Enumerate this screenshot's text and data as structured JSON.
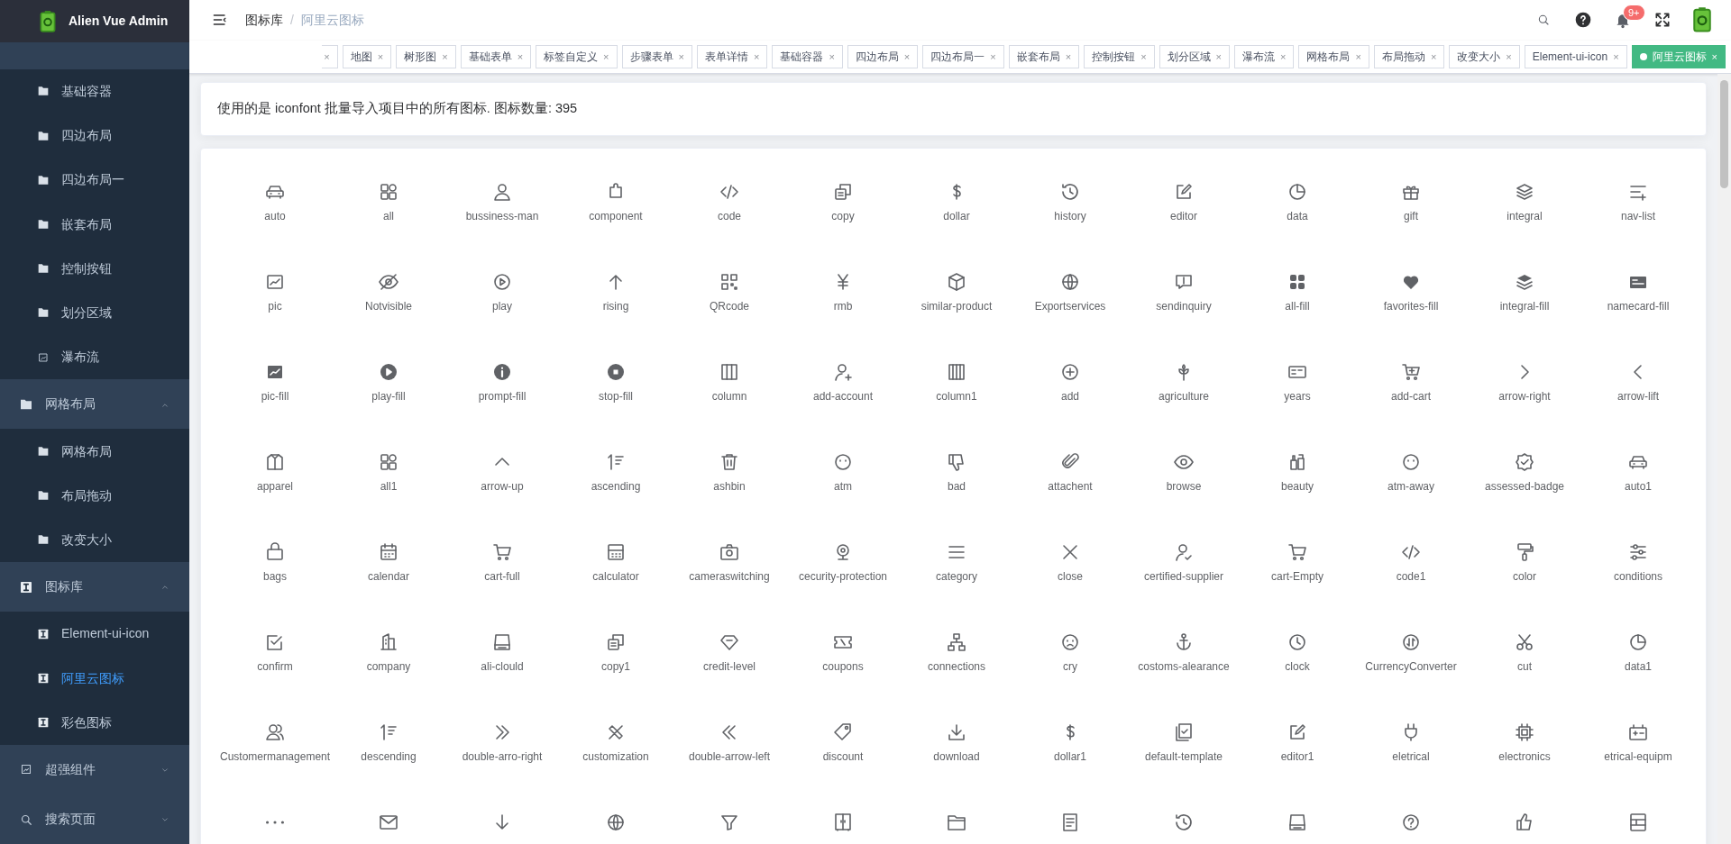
{
  "app": {
    "title": "Alien Vue Admin"
  },
  "sidebar": {
    "items": [
      {
        "kind": "group",
        "expanded": true,
        "children": [
          {
            "label": "基础容器",
            "selected": false
          },
          {
            "label": "四边布局",
            "selected": false
          },
          {
            "label": "四边布局一",
            "selected": false
          },
          {
            "label": "嵌套布局",
            "selected": false
          },
          {
            "label": "控制按钮",
            "selected": false
          },
          {
            "label": "划分区域",
            "selected": false
          },
          {
            "label": "瀑布流",
            "selected": false
          }
        ]
      },
      {
        "kind": "group",
        "label": "网格布局",
        "expanded": true,
        "children": [
          {
            "label": "网格布局",
            "selected": false
          },
          {
            "label": "布局拖动",
            "selected": false
          },
          {
            "label": "改变大小",
            "selected": false
          }
        ]
      },
      {
        "kind": "group",
        "label": "图标库",
        "expanded": true,
        "children": [
          {
            "label": "Element-ui-icon",
            "selected": false
          },
          {
            "label": "阿里云图标",
            "selected": true
          },
          {
            "label": "彩色图标",
            "selected": false
          }
        ]
      },
      {
        "kind": "group",
        "label": "超强组件",
        "expanded": false
      },
      {
        "kind": "group",
        "label": "搜索页面",
        "expanded": false
      }
    ]
  },
  "header": {
    "breadcrumb": [
      {
        "label": "图标库"
      },
      {
        "label": "阿里云图标"
      }
    ],
    "separator": "/",
    "notifications": {
      "badge": "9+"
    }
  },
  "tags": [
    {
      "kind": "cut",
      "close": "×"
    },
    {
      "kind": "tag",
      "label": "地图",
      "close": "×",
      "selected": false
    },
    {
      "kind": "tag",
      "label": "树形图",
      "close": "×",
      "selected": false
    },
    {
      "kind": "tag",
      "label": "基础表单",
      "close": "×",
      "selected": false
    },
    {
      "kind": "tag",
      "label": "标签自定义",
      "close": "×",
      "selected": false
    },
    {
      "kind": "tag",
      "label": "步骤表单",
      "close": "×",
      "selected": false
    },
    {
      "kind": "tag",
      "label": "表单详情",
      "close": "×",
      "selected": false
    },
    {
      "kind": "tag",
      "label": "基础容器",
      "close": "×",
      "selected": false
    },
    {
      "kind": "tag",
      "label": "四边布局",
      "close": "×",
      "selected": false
    },
    {
      "kind": "tag",
      "label": "四边布局一",
      "close": "×",
      "selected": false
    },
    {
      "kind": "tag",
      "label": "嵌套布局",
      "close": "×",
      "selected": false
    },
    {
      "kind": "tag",
      "label": "控制按钮",
      "close": "×",
      "selected": false
    },
    {
      "kind": "tag",
      "label": "划分区域",
      "close": "×",
      "selected": false
    },
    {
      "kind": "tag",
      "label": "瀑布流",
      "close": "×",
      "selected": false
    },
    {
      "kind": "tag",
      "label": "网格布局",
      "close": "×",
      "selected": false
    },
    {
      "kind": "tag",
      "label": "布局拖动",
      "close": "×",
      "selected": false
    },
    {
      "kind": "tag",
      "label": "改变大小",
      "close": "×",
      "selected": false
    },
    {
      "kind": "tag",
      "label": "Element-ui-icon",
      "close": "×",
      "selected": false
    },
    {
      "kind": "tag",
      "label": "阿里云图标",
      "close": "×",
      "selected": true
    }
  ],
  "info": {
    "text": "使用的是 iconfont 批量导入项目中的所有图标. 图标数量: 395"
  },
  "icons": {
    "items": [
      {
        "kind": "named",
        "label": "auto"
      },
      {
        "kind": "named",
        "label": "all"
      },
      {
        "kind": "named",
        "label": "bussiness-man"
      },
      {
        "kind": "named",
        "label": "component"
      },
      {
        "kind": "named",
        "label": "code"
      },
      {
        "kind": "named",
        "label": "copy"
      },
      {
        "kind": "named",
        "label": "dollar"
      },
      {
        "kind": "named",
        "label": "history"
      },
      {
        "kind": "named",
        "label": "editor"
      },
      {
        "kind": "named",
        "label": "data"
      },
      {
        "kind": "named",
        "label": "gift"
      },
      {
        "kind": "named",
        "label": "integral"
      },
      {
        "kind": "named",
        "label": "nav-list"
      },
      {
        "kind": "named",
        "label": "pic"
      },
      {
        "kind": "named",
        "label": "Notvisible"
      },
      {
        "kind": "named",
        "label": "play"
      },
      {
        "kind": "named",
        "label": "rising"
      },
      {
        "kind": "named",
        "label": "QRcode"
      },
      {
        "kind": "named",
        "label": "rmb"
      },
      {
        "kind": "named",
        "label": "similar-product"
      },
      {
        "kind": "named",
        "label": "Exportservices"
      },
      {
        "kind": "named",
        "label": "sendinquiry"
      },
      {
        "kind": "named",
        "label": "all-fill"
      },
      {
        "kind": "named",
        "label": "favorites-fill"
      },
      {
        "kind": "named",
        "label": "integral-fill"
      },
      {
        "kind": "named",
        "label": "namecard-fill"
      },
      {
        "kind": "named",
        "label": "pic-fill"
      },
      {
        "kind": "named",
        "label": "play-fill"
      },
      {
        "kind": "named",
        "label": "prompt-fill"
      },
      {
        "kind": "named",
        "label": "stop-fill"
      },
      {
        "kind": "named",
        "label": "column"
      },
      {
        "kind": "named",
        "label": "add-account"
      },
      {
        "kind": "named",
        "label": "column1"
      },
      {
        "kind": "named",
        "label": "add"
      },
      {
        "kind": "named",
        "label": "agriculture"
      },
      {
        "kind": "named",
        "label": "years"
      },
      {
        "kind": "named",
        "label": "add-cart"
      },
      {
        "kind": "named",
        "label": "arrow-right"
      },
      {
        "kind": "named",
        "label": "arrow-lift"
      },
      {
        "kind": "named",
        "label": "apparel"
      },
      {
        "kind": "named",
        "label": "all1"
      },
      {
        "kind": "named",
        "label": "arrow-up"
      },
      {
        "kind": "named",
        "label": "ascending"
      },
      {
        "kind": "named",
        "label": "ashbin"
      },
      {
        "kind": "named",
        "label": "atm"
      },
      {
        "kind": "named",
        "label": "bad"
      },
      {
        "kind": "named",
        "label": "attachent"
      },
      {
        "kind": "named",
        "label": "browse"
      },
      {
        "kind": "named",
        "label": "beauty"
      },
      {
        "kind": "named",
        "label": "atm-away"
      },
      {
        "kind": "named",
        "label": "assessed-badge"
      },
      {
        "kind": "named",
        "label": "auto1"
      },
      {
        "kind": "named",
        "label": "bags"
      },
      {
        "kind": "named",
        "label": "calendar"
      },
      {
        "kind": "named",
        "label": "cart-full"
      },
      {
        "kind": "named",
        "label": "calculator"
      },
      {
        "kind": "named",
        "label": "cameraswitching"
      },
      {
        "kind": "named",
        "label": "cecurity-protection"
      },
      {
        "kind": "named",
        "label": "category"
      },
      {
        "kind": "named",
        "label": "close"
      },
      {
        "kind": "named",
        "label": "certified-supplier"
      },
      {
        "kind": "named",
        "label": "cart-Empty"
      },
      {
        "kind": "named",
        "label": "code1"
      },
      {
        "kind": "named",
        "label": "color"
      },
      {
        "kind": "named",
        "label": "conditions"
      },
      {
        "kind": "named",
        "label": "confirm"
      },
      {
        "kind": "named",
        "label": "company"
      },
      {
        "kind": "named",
        "label": "ali-clould"
      },
      {
        "kind": "named",
        "label": "copy1"
      },
      {
        "kind": "named",
        "label": "credit-level"
      },
      {
        "kind": "named",
        "label": "coupons"
      },
      {
        "kind": "named",
        "label": "connections"
      },
      {
        "kind": "named",
        "label": "cry"
      },
      {
        "kind": "named",
        "label": "costoms-alearance"
      },
      {
        "kind": "named",
        "label": "clock"
      },
      {
        "kind": "named",
        "label": "CurrencyConverter"
      },
      {
        "kind": "named",
        "label": "cut"
      },
      {
        "kind": "named",
        "label": "data1"
      },
      {
        "kind": "named",
        "label": "Customermanagement"
      },
      {
        "kind": "named",
        "label": "descending"
      },
      {
        "kind": "named",
        "label": "double-arro-right"
      },
      {
        "kind": "named",
        "label": "customization"
      },
      {
        "kind": "named",
        "label": "double-arrow-left"
      },
      {
        "kind": "named",
        "label": "discount"
      },
      {
        "kind": "named",
        "label": "download"
      },
      {
        "kind": "named",
        "label": "dollar1"
      },
      {
        "kind": "named",
        "label": "default-template"
      },
      {
        "kind": "named",
        "label": "editor1"
      },
      {
        "kind": "named",
        "label": "eletrical"
      },
      {
        "kind": "named",
        "label": "electronics"
      },
      {
        "kind": "named",
        "label": "etrical-equipm"
      },
      {
        "kind": "cut"
      },
      {
        "kind": "cut"
      },
      {
        "kind": "cut"
      },
      {
        "kind": "cut"
      },
      {
        "kind": "cut"
      },
      {
        "kind": "cut"
      },
      {
        "kind": "cut"
      },
      {
        "kind": "cut"
      },
      {
        "kind": "cut"
      },
      {
        "kind": "cut"
      },
      {
        "kind": "cut"
      },
      {
        "kind": "cut"
      },
      {
        "kind": "cut"
      }
    ]
  }
}
